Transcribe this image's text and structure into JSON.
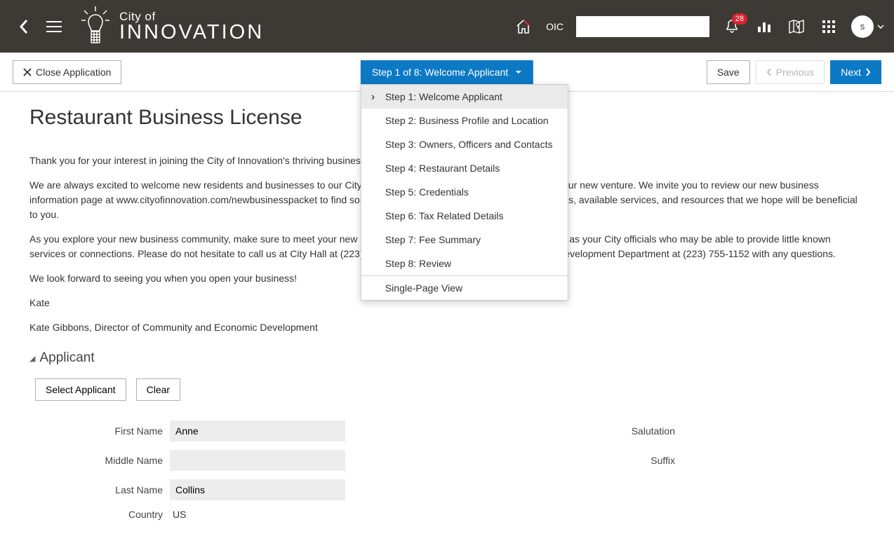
{
  "header": {
    "city_text": "City of",
    "brand": "INNOVATION",
    "oic_label": "OIC",
    "notification_count": "28",
    "avatar_initial": "s"
  },
  "actionbar": {
    "close_label": "Close Application",
    "save_label": "Save",
    "previous_label": "Previous",
    "next_label": "Next"
  },
  "steps": {
    "current_label": "Step 1 of 8: Welcome Applicant",
    "items": [
      "Step 1: Welcome Applicant",
      "Step 2: Business Profile and Location",
      "Step 3: Owners, Officers and Contacts",
      "Step 4: Restaurant Details",
      "Step 5: Credentials",
      "Step 6: Tax Related Details",
      "Step 7: Fee Summary",
      "Step 8: Review"
    ],
    "single_page": "Single-Page View"
  },
  "page": {
    "title": "Restaurant Business License",
    "paragraphs": [
      "Thank you for your interest in joining the City of Innovation's thriving business community.",
      "We are always excited to welcome new residents and businesses to our City and we are particularly excited to join you in your new venture. We invite you to review our new business information page at www.cityofinnovation.com/newbusinesspacket to find some helpful details about application requirements, available services, and resources that we hope will be beneficial to you.",
      "As you explore your new business community, make sure to meet your new Chamber of Commerce board members as well as your City officials who may be able to provide little known services or connections. Please do not hesitate to call us at City Hall at (223) 755-1120, or the Community and Economic Development Department at (223) 755-1152 with any questions.",
      "We look forward to seeing you when you open your business!",
      "Kate",
      "Kate Gibbons, Director of Community and Economic Development"
    ]
  },
  "applicant": {
    "header": "Applicant",
    "select_btn": "Select Applicant",
    "clear_btn": "Clear",
    "labels": {
      "first_name": "First Name",
      "middle_name": "Middle Name",
      "last_name": "Last Name",
      "country": "Country",
      "salutation": "Salutation",
      "suffix": "Suffix"
    },
    "values": {
      "first_name": "Anne",
      "middle_name": "",
      "last_name": "Collins",
      "country": "US",
      "salutation": "",
      "suffix": ""
    }
  }
}
